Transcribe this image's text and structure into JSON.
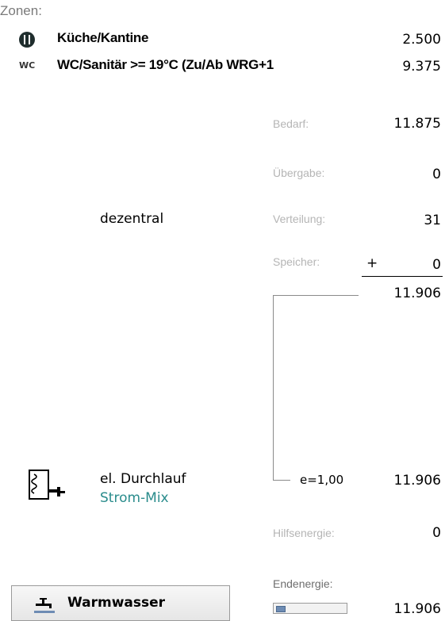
{
  "zonen": {
    "title": "Zonen:",
    "items": [
      {
        "icon": "restaurant-icon",
        "name": "Küche/Kantine",
        "value": "2.500"
      },
      {
        "icon": "wc-icon",
        "icon_text": "WC",
        "name": "WC/Sanitär >= 19°C (Zu/Ab WRG+1",
        "value": "9.375"
      }
    ]
  },
  "distribution": {
    "label": "dezentral",
    "bedarf_label": "Bedarf:",
    "bedarf_value": "11.875",
    "uebergabe_label": "Übergabe:",
    "uebergabe_value": "0",
    "verteilung_label": "Verteilung:",
    "verteilung_value": "31",
    "speicher_label": "Speicher:",
    "speicher_sign": "+",
    "speicher_value": "0",
    "sum_value": "11.906"
  },
  "generator": {
    "icon": "water-heater-icon",
    "name": "el. Durchlauf",
    "energy_source": "Strom-Mix",
    "efficiency": "e=1,00",
    "value": "11.906"
  },
  "hilfsenergie": {
    "label": "Hilfsenergie:",
    "value": "0"
  },
  "endenergie": {
    "label": "Endenergie:",
    "value": "11.906",
    "progress": 0.12
  },
  "button": {
    "icon": "faucet-icon",
    "label": "Warmwasser"
  },
  "colors": {
    "accent_teal": "#2a8c8c",
    "muted_label": "#b5b5b5"
  }
}
